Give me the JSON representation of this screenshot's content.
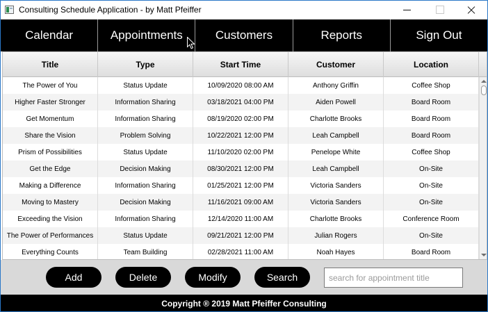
{
  "window": {
    "title": "Consulting Schedule Application - by Matt Pfeiffer"
  },
  "nav": {
    "items": [
      {
        "label": "Calendar"
      },
      {
        "label": "Appointments"
      },
      {
        "label": "Customers"
      },
      {
        "label": "Reports"
      },
      {
        "label": "Sign Out"
      }
    ]
  },
  "table": {
    "columns": [
      "Title",
      "Type",
      "Start Time",
      "Customer",
      "Location"
    ],
    "rows": [
      [
        "The Power of You",
        "Status Update",
        "10/09/2020 08:00 AM",
        "Anthony Griffin",
        "Coffee Shop"
      ],
      [
        "Higher Faster Stronger",
        "Information Sharing",
        "03/18/2021 04:00 PM",
        "Aiden Powell",
        "Board Room"
      ],
      [
        "Get Momentum",
        "Information Sharing",
        "08/19/2020 02:00 PM",
        "Charlotte Brooks",
        "Board Room"
      ],
      [
        "Share the Vision",
        "Problem Solving",
        "10/22/2021 12:00 PM",
        "Leah Campbell",
        "Board Room"
      ],
      [
        "Prism of Possibilities",
        "Status Update",
        "11/10/2020 02:00 PM",
        "Penelope White",
        "Coffee Shop"
      ],
      [
        "Get the Edge",
        "Decision Making",
        "08/30/2021 12:00 PM",
        "Leah Campbell",
        "On-Site"
      ],
      [
        "Making a Difference",
        "Information Sharing",
        "01/25/2021 12:00 PM",
        "Victoria Sanders",
        "On-Site"
      ],
      [
        "Moving to Mastery",
        "Decision Making",
        "11/16/2021 09:00 AM",
        "Victoria Sanders",
        "On-Site"
      ],
      [
        "Exceeding the Vision",
        "Information Sharing",
        "12/14/2020 11:00 AM",
        "Charlotte Brooks",
        "Conference Room"
      ],
      [
        "The Power of Performances",
        "Status Update",
        "09/21/2021 12:00 PM",
        "Julian Rogers",
        "On-Site"
      ],
      [
        "Everything Counts",
        "Team Building",
        "02/28/2021 11:00 AM",
        "Noah Hayes",
        "Board Room"
      ]
    ]
  },
  "actions": {
    "add_label": "Add",
    "delete_label": "Delete",
    "modify_label": "Modify",
    "search_label": "Search",
    "search_placeholder": "search for appointment title",
    "search_value": ""
  },
  "footer": {
    "text": "Copyright ® 2019 Matt Pfeiffer Consulting"
  }
}
